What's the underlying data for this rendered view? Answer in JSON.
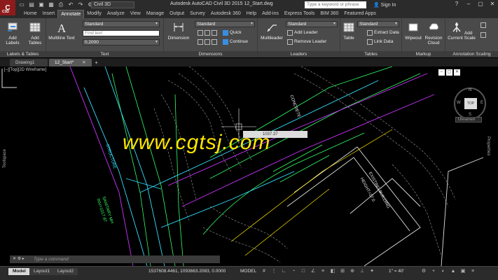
{
  "app": {
    "icon_label": "C3D",
    "workspace": "Civil 3D",
    "window_title": "Autodesk AutoCAD Civil 3D 2015    12_Start.dwg",
    "search_placeholder": "Type a keyword or phrase",
    "signin_label": "Sign In"
  },
  "ribbon_tabs": [
    "Home",
    "Insert",
    "Annotate",
    "Modify",
    "Analyze",
    "View",
    "Manage",
    "Output",
    "Survey",
    "Autodesk 360",
    "Help",
    "Add-ins",
    "Express Tools",
    "BIM 360",
    "Featured Apps"
  ],
  "active_ribbon_tab": "Annotate",
  "panels": {
    "labels_tables": {
      "title": "Labels & Tables",
      "add_labels": "Add Labels",
      "add_tables": "Add Tables"
    },
    "text": {
      "title": "Text",
      "multiline_text": "Multiline Text",
      "style": "Standard",
      "find_text_placeholder": "Find text",
      "height": "0.2000"
    },
    "dimensions": {
      "title": "Dimensions",
      "dimension": "Dimension",
      "style": "Standard",
      "quick": "Quick",
      "continue": "Continue"
    },
    "leaders": {
      "title": "Leaders",
      "multileader": "Multileader",
      "style": "Standard",
      "add_leader": "Add Leader",
      "remove_leader": "Remove Leader"
    },
    "tables": {
      "title": "Tables",
      "table": "Table",
      "style": "Standard",
      "extract_data": "Extract Data",
      "link_data": "Link Data"
    },
    "markup": {
      "title": "Markup",
      "wipeout": "Wipeout",
      "revision_cloud": "Revision Cloud"
    },
    "annotation_scaling": {
      "title": "Annotation Scaling",
      "add_current_scale": "Add Current Scale"
    }
  },
  "doc_tabs": [
    {
      "label": "Drawing1",
      "active": false
    },
    {
      "label": "12_Start*",
      "active": true
    }
  ],
  "drawing": {
    "view_label": "[–][Top][2D Wireframe]",
    "toolspace_label": "Toolspace",
    "properties_label": "Properties",
    "viewcube_top": "TOP",
    "compass_n": "N",
    "compass_s": "S",
    "compass_e": "E",
    "compass_w": "W",
    "ucs_label": "Unnamed",
    "coord_tooltip": "1037.37",
    "watermark": "www.cgtsj.com",
    "command_prompt": "Type a command",
    "annotations": [
      "EXISTING BUILDING",
      "HEIGHT=27.0",
      "SANITARY MH",
      "INV=1017.87",
      "CONCRETE",
      "STRUCTURE"
    ]
  },
  "status": {
    "layout_tabs": [
      {
        "label": "Model",
        "active": true
      },
      {
        "label": "Layout1",
        "active": false
      },
      {
        "label": "Layout2",
        "active": false
      }
    ],
    "coordinates": "1537608.4461, 1093663.2083, 0.0000",
    "mode": "MODEL",
    "scale": "1\" = 40'"
  },
  "colors": {
    "accent_red": "#8e1b1b",
    "cad_green": "#33ff66",
    "cad_cyan": "#33e0ff",
    "cad_magenta": "#cc33ff",
    "cad_yellow": "#ffe600"
  }
}
